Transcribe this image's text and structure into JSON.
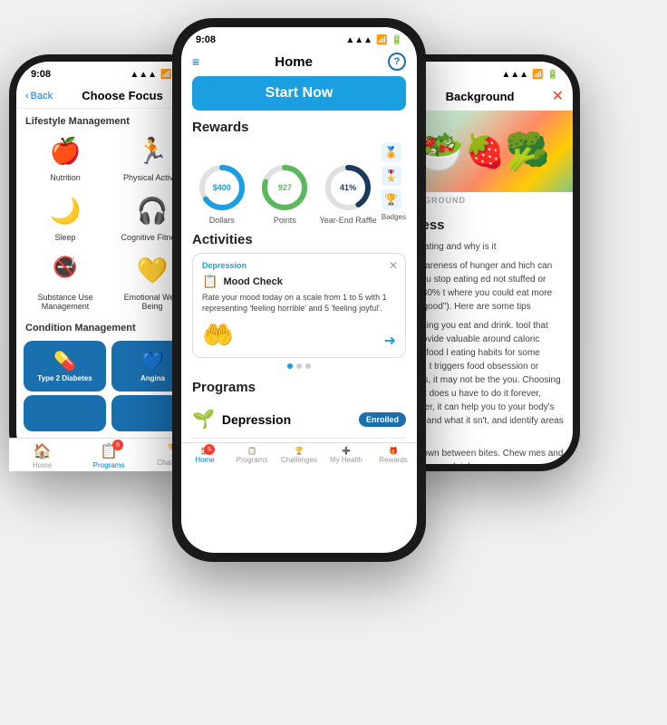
{
  "app": {
    "status_time": "9:08",
    "signal": "●●●",
    "wifi": "WiFi",
    "battery": "■■■"
  },
  "left_phone": {
    "back_label": "Back",
    "title": "Choose Focus",
    "lifestyle_heading": "Lifestyle Management",
    "lifestyle_items": [
      {
        "label": "Nutrition",
        "icon": "🍎"
      },
      {
        "label": "Physical Activity",
        "icon": "🏃"
      },
      {
        "label": "Sleep",
        "icon": "🌙"
      },
      {
        "label": "Cognitive Fitness",
        "icon": "🎧"
      },
      {
        "label": "Substance Use Management",
        "icon": "🚭"
      },
      {
        "label": "Emotional Well-Being",
        "icon": "💛"
      }
    ],
    "condition_heading": "Condition Management",
    "condition_items": [
      {
        "label": "Type 2 Diabetes",
        "color": "#1a6faf"
      },
      {
        "label": "Angina",
        "color": "#1a6faf"
      }
    ],
    "tabs": [
      {
        "label": "Home",
        "icon": "🏠",
        "active": false,
        "badge": null
      },
      {
        "label": "Programs",
        "icon": "📋",
        "active": true,
        "badge": "5"
      },
      {
        "label": "Challenges",
        "icon": "🏆",
        "active": false,
        "badge": null
      }
    ]
  },
  "center_phone": {
    "title": "Home",
    "start_now": "Start Now",
    "rewards_title": "Rewards",
    "rewards": [
      {
        "value": "$400",
        "label": "Dollars",
        "color": "#1a9fe0",
        "pct": 65
      },
      {
        "value": "927",
        "label": "Points",
        "color": "#5cb85c",
        "pct": 80
      },
      {
        "value": "41%",
        "label": "Year-End Raffle",
        "color": "#1a3a5c",
        "pct": 41
      }
    ],
    "badges_label": "Badges",
    "activities_title": "Activities",
    "activity_tag": "Depression",
    "activity_check_label": "Mood Check",
    "activity_desc": "Rate your mood today on a scale from 1 to 5 with 1 representing 'feeling horrible' and 5 'feeling joyful'.",
    "programs_title": "Programs",
    "program_name": "Depression",
    "enrolled_label": "Enrolled",
    "tabs": [
      {
        "label": "Home",
        "icon": "🏠",
        "active": true,
        "badge": "5"
      },
      {
        "label": "Programs",
        "icon": "📋",
        "active": false,
        "badge": null
      },
      {
        "label": "Challenges",
        "icon": "🏆",
        "active": false,
        "badge": null
      },
      {
        "label": "My Health",
        "icon": "➕",
        "active": false,
        "badge": null
      },
      {
        "label": "Rewards",
        "icon": "🎁",
        "active": false,
        "badge": null
      }
    ]
  },
  "right_phone": {
    "title": "Background",
    "bg_tag": "BACKGROUND",
    "section_title": "fulness",
    "intro": "ndful eating and why is it",
    "para1": "ves awareness of hunger and hich can help you stop eating ed not stuffed or about 80% t where you could eat more but e \"good\"). Here are some tips",
    "para2": "everything you eat and drink. tool that can provide valuable around caloric intake, food l eating habits for some people. t triggers food obsession or dencies, it may not be the you. Choosing to track does u have to do it forever, However, it can help you to your body's needs, and what it sn't, and identify areas for t.",
    "para3": "nsils down between bites. Chew mes and swallow completely"
  }
}
